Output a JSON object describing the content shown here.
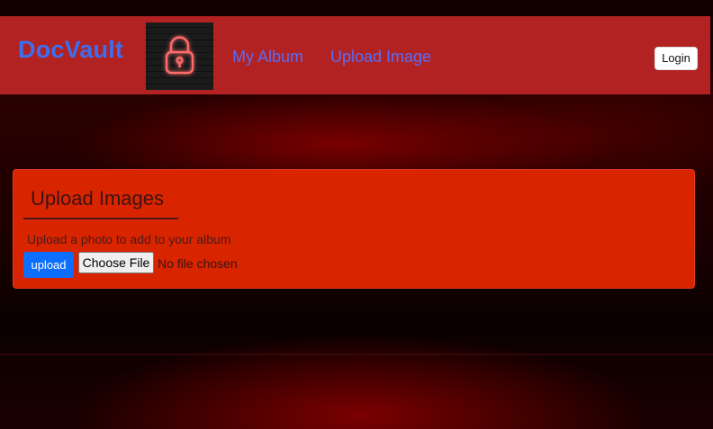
{
  "navbar": {
    "brand": "DocVault",
    "links": [
      {
        "label": "My Album"
      },
      {
        "label": "Upload Image"
      }
    ],
    "login_label": "Login",
    "logo_icon": "neon-padlock-icon"
  },
  "upload_card": {
    "title": "Upload Images",
    "description": "Upload a photo to add to your album",
    "upload_button_label": "upload",
    "choose_file_label": "Choose File",
    "file_status": "No file chosen"
  },
  "colors": {
    "navbar_bg": "#b22222",
    "brand": "#3b6ff0",
    "nav_link": "#5a6cf5",
    "card_bg": "#d92400",
    "upload_button": "#0d6efd"
  }
}
